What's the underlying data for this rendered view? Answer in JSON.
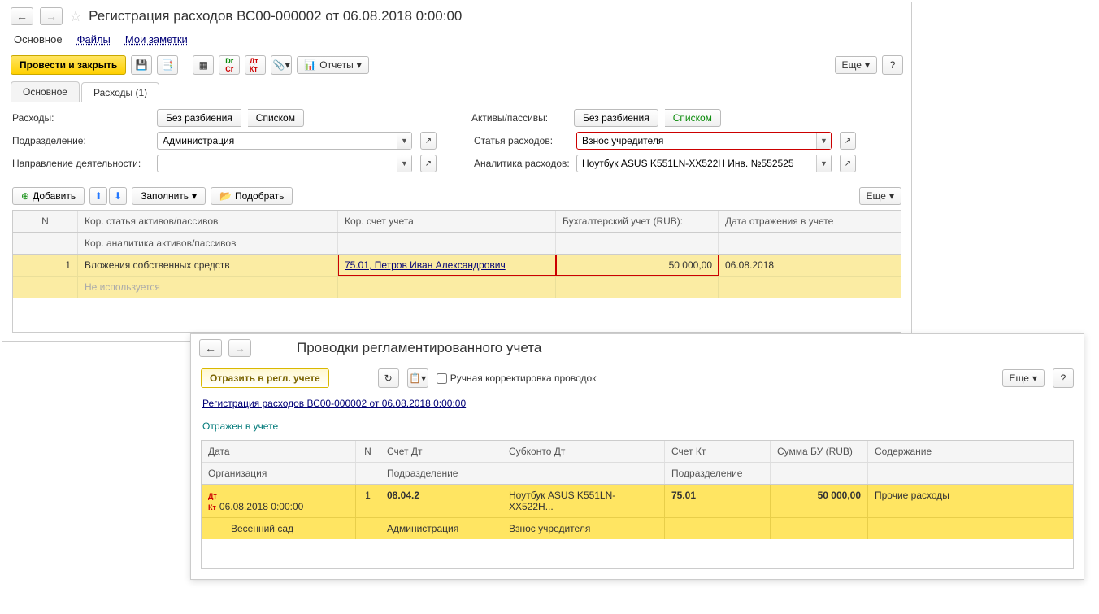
{
  "header": {
    "title": "Регистрация расходов ВС00-000002 от 06.08.2018 0:00:00"
  },
  "top_tabs": {
    "main": "Основное",
    "files": "Файлы",
    "notes": "Мои заметки"
  },
  "toolbar": {
    "post_close": "Провести и закрыть",
    "reports": "Отчеты",
    "more": "Еще",
    "help": "?"
  },
  "tabs": {
    "main": "Основное",
    "expenses": "Расходы (1)"
  },
  "form": {
    "expenses_label": "Расходы:",
    "no_split": "Без разбиения",
    "as_list": "Списком",
    "assets_label": "Активы/пассивы:",
    "division_label": "Подразделение:",
    "division_value": "Администрация",
    "article_label": "Статья расходов:",
    "article_value": "Взнос учредителя",
    "direction_label": "Направление деятельности:",
    "direction_value": "",
    "analytics_label": "Аналитика расходов:",
    "analytics_value": "Ноутбук ASUS K551LN-XX522H Инв. №552525"
  },
  "tbl_toolbar": {
    "add": "Добавить",
    "fill": "Заполнить",
    "pick": "Подобрать",
    "more": "Еще"
  },
  "grid": {
    "headers": {
      "n": "N",
      "c1a": "Кор. статья активов/пассивов",
      "c1b": "Кор. аналитика активов/пассивов",
      "c2": "Кор. счет учета",
      "c3": "Бухгалтерский учет (RUB):",
      "c4": "Дата отражения в учете"
    },
    "row": {
      "n": "1",
      "c1a": "Вложения собственных средств",
      "c1b": "Не используется",
      "c2": "75.01, Петров Иван Александрович",
      "c3": "50 000,00",
      "c4": "06.08.2018"
    }
  },
  "w2": {
    "title": "Проводки регламентированного учета",
    "reflect": "Отразить в регл. учете",
    "manual": "Ручная корректировка проводок",
    "doclink": "Регистрация расходов ВС00-000002 от 06.08.2018 0:00:00",
    "status": "Отражен в учете",
    "more": "Еще",
    "help": "?",
    "headers": {
      "date": "Дата",
      "org": "Организация",
      "n": "N",
      "sdt": "Счет Дт",
      "div": "Подразделение",
      "sub": "Субконто Дт",
      "skt": "Счет Кт",
      "div2": "Подразделение",
      "sum": "Сумма БУ (RUB)",
      "cont": "Содержание"
    },
    "row": {
      "date": "06.08.2018 0:00:00",
      "org": "Весенний сад",
      "n": "1",
      "sdt": "08.04.2",
      "div": "Администрация",
      "sub1": "Ноутбук ASUS K551LN-XX522H...",
      "sub2": "Взнос учредителя",
      "skt": "75.01",
      "sum": "50 000,00",
      "cont": "Прочие расходы"
    }
  }
}
